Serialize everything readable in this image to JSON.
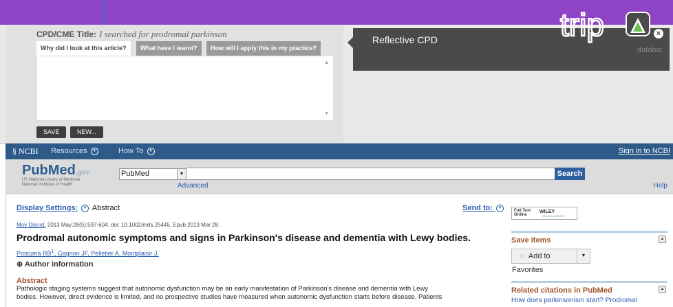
{
  "cpd": {
    "title_label": "CPD/CME Title:",
    "title_value": "I searched for prodromal parkinson",
    "tabs": [
      {
        "label": "Why did I look at this article?",
        "active": true
      },
      {
        "label": "What have I learnt?",
        "active": false
      },
      {
        "label": "How will I apply this in my practice?",
        "active": false
      }
    ],
    "save_label": "SAVE",
    "new_label": "NEW...",
    "panel_title": "Reflective CPD",
    "logo_text": "trip",
    "logo_sub": "database",
    "close_label": "×"
  },
  "ncbi": {
    "logo": "NCBI",
    "resources": "Resources",
    "howto": "How To",
    "signin": "Sign in to NCBI"
  },
  "search": {
    "logo_pub": "Pub",
    "logo_med": "Med",
    "logo_gov": ".gov",
    "org1": "US National Library of Medicine",
    "org2": "National Institutes of Health",
    "db": "PubMed",
    "query": "",
    "button": "Search",
    "advanced": "Advanced",
    "help": "Help"
  },
  "article": {
    "display_settings": "Display Settings:",
    "format": "Abstract",
    "send_to": "Send to:",
    "journal": "Mov Disord.",
    "citation_rest": " 2013 May;28(5):597-604. doi: 10.1002/mds.25445. Epub 2013 Mar 28.",
    "title": "Prodromal autonomic symptoms and signs in Parkinson's disease and dementia with Lewy bodies.",
    "authors": [
      "Postuma RB",
      "Gagnon JF",
      "Pelletier A",
      "Montplaisir J"
    ],
    "author_sup": "1",
    "author_info": "Author information",
    "abstract_heading": "Abstract",
    "abstract_line1": "Pathologic staging systems suggest that autonomic dysfunction may be an early manifestation of Parkinson's disease and dementia with Lewy",
    "abstract_line2": "bodies. However, direct evidence is limited, and no prospective studies have measured when autonomic dysfunction starts before disease. Patients"
  },
  "sidebar": {
    "fulltext_1": "Full Text",
    "fulltext_2": "Online",
    "wiley": "WILEY",
    "wiley_sub": "ONLINE LIBRARY",
    "save_items": "Save items",
    "add_favorites": "Add to Favorites",
    "related": "Related citations in PubMed",
    "related_link": "How does parkinsonism start? Prodromal"
  },
  "colors": {
    "topbar": "#8e44c4",
    "ncbi_bar": "#2e5a8a",
    "accent_heading": "#a0522d",
    "link": "#2a5db0"
  }
}
